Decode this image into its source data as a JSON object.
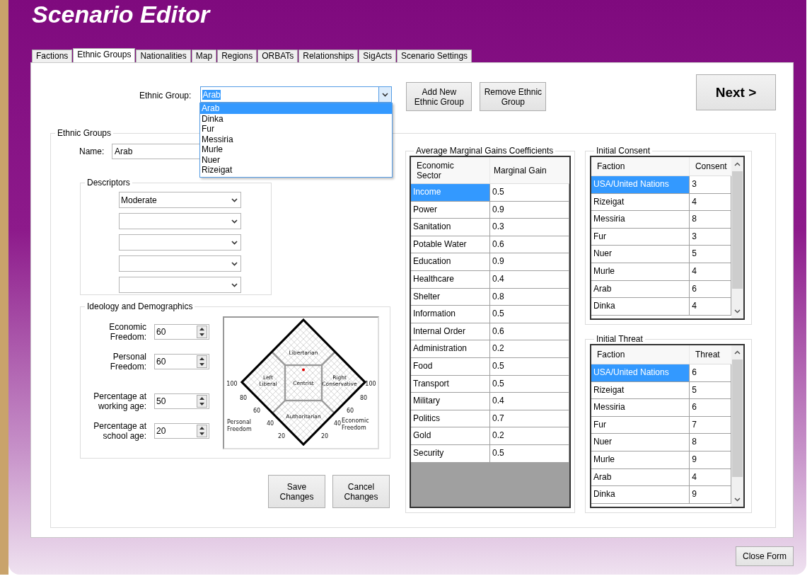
{
  "window": {
    "title": "Scenario Editor"
  },
  "tabs": [
    {
      "label": "Factions",
      "selected": false
    },
    {
      "label": "Ethnic Groups",
      "selected": true
    },
    {
      "label": "Nationalities",
      "selected": false
    },
    {
      "label": "Map",
      "selected": false
    },
    {
      "label": "Regions",
      "selected": false
    },
    {
      "label": "ORBATs",
      "selected": false
    },
    {
      "label": "Relationships",
      "selected": false
    },
    {
      "label": "SigActs",
      "selected": false
    },
    {
      "label": "Scenario Settings",
      "selected": false
    }
  ],
  "ethnic_group_selector": {
    "label": "Ethnic Group:",
    "value": "Arab",
    "expanded": true,
    "options": [
      {
        "label": "Arab",
        "selected": true
      },
      {
        "label": "Dinka",
        "selected": false
      },
      {
        "label": "Fur",
        "selected": false
      },
      {
        "label": "Messiria",
        "selected": false
      },
      {
        "label": "Murle",
        "selected": false
      },
      {
        "label": "Nuer",
        "selected": false
      },
      {
        "label": "Rizeigat",
        "selected": false
      }
    ]
  },
  "top_buttons": [
    {
      "label": "Add New\nEthnic Group"
    },
    {
      "label": "Remove Ethnic\nGroup"
    }
  ],
  "next_button": {
    "label": "Next >"
  },
  "ethnic_groups": {
    "title": "Ethnic Groups",
    "name_label": "Name:",
    "name_value": "Arab",
    "descriptors": {
      "title": "Descriptors",
      "slots": [
        {
          "kind": "selected",
          "value": "Moderate"
        },
        {
          "kind": "empty"
        },
        {
          "kind": "empty"
        },
        {
          "kind": "empty"
        },
        {
          "kind": "empty"
        }
      ]
    },
    "ideology": {
      "title": "Ideology and Demographics",
      "fields": [
        {
          "label": "Economic\nFreedom:",
          "value": "60"
        },
        {
          "label": "Personal\nFreedom:",
          "value": "60"
        },
        {
          "label": "Percentage at\nworking age:",
          "value": "50"
        },
        {
          "label": "Percentage at\nschool age:",
          "value": "20"
        }
      ],
      "diagram": {
        "regions": [
          "Libertarian",
          "Left\nLiberal",
          "Centrist",
          "Right\nConservative",
          "Authoritarian"
        ],
        "left_ticks": [
          "100",
          "80",
          "60",
          "40",
          "20"
        ],
        "right_ticks": [
          "20",
          "40",
          "60",
          "80",
          "100"
        ],
        "left_axis": "Personal\nFreedom",
        "right_axis": "Economic\nFreedom"
      }
    },
    "actions": [
      {
        "label": "Save\nChanges"
      },
      {
        "label": "Cancel\nChanges"
      }
    ]
  },
  "marginal_gains": {
    "title": "Average Marginal Gains Coefficients",
    "columns": [
      "Economic\nSector",
      "Marginal Gain"
    ],
    "rows": [
      {
        "cells": [
          "Income",
          "0.5"
        ],
        "selected": true
      },
      {
        "cells": [
          "Power",
          "0.9"
        ],
        "selected": false
      },
      {
        "cells": [
          "Sanitation",
          "0.3"
        ],
        "selected": false
      },
      {
        "cells": [
          "Potable Water",
          "0.6"
        ],
        "selected": false
      },
      {
        "cells": [
          "Education",
          "0.9"
        ],
        "selected": false
      },
      {
        "cells": [
          "Healthcare",
          "0.4"
        ],
        "selected": false
      },
      {
        "cells": [
          "Shelter",
          "0.8"
        ],
        "selected": false
      },
      {
        "cells": [
          "Information",
          "0.5"
        ],
        "selected": false
      },
      {
        "cells": [
          "Internal Order",
          "0.6"
        ],
        "selected": false
      },
      {
        "cells": [
          "Administration",
          "0.2"
        ],
        "selected": false
      },
      {
        "cells": [
          "Food",
          "0.5"
        ],
        "selected": false
      },
      {
        "cells": [
          "Transport",
          "0.5"
        ],
        "selected": false
      },
      {
        "cells": [
          "Military",
          "0.4"
        ],
        "selected": false
      },
      {
        "cells": [
          "Politics",
          "0.7"
        ],
        "selected": false
      },
      {
        "cells": [
          "Gold",
          "0.2"
        ],
        "selected": false
      },
      {
        "cells": [
          "Security",
          "0.5"
        ],
        "selected": false
      }
    ]
  },
  "initial_consent": {
    "title": "Initial Consent",
    "columns": [
      "Faction",
      "Consent"
    ],
    "rows": [
      {
        "cells": [
          "USA/United Nations",
          "3"
        ],
        "selected": true
      },
      {
        "cells": [
          "Rizeigat",
          "4"
        ],
        "selected": false
      },
      {
        "cells": [
          "Messiria",
          "8"
        ],
        "selected": false
      },
      {
        "cells": [
          "Fur",
          "3"
        ],
        "selected": false
      },
      {
        "cells": [
          "Nuer",
          "5"
        ],
        "selected": false
      },
      {
        "cells": [
          "Murle",
          "4"
        ],
        "selected": false
      },
      {
        "cells": [
          "Arab",
          "6"
        ],
        "selected": false
      },
      {
        "cells": [
          "Dinka",
          "4"
        ],
        "selected": false
      }
    ]
  },
  "initial_threat": {
    "title": "Initial Threat",
    "columns": [
      "Faction",
      "Threat"
    ],
    "rows": [
      {
        "cells": [
          "USA/United Nations",
          "6"
        ],
        "selected": true
      },
      {
        "cells": [
          "Rizeigat",
          "5"
        ],
        "selected": false
      },
      {
        "cells": [
          "Messiria",
          "6"
        ],
        "selected": false
      },
      {
        "cells": [
          "Fur",
          "7"
        ],
        "selected": false
      },
      {
        "cells": [
          "Nuer",
          "8"
        ],
        "selected": false
      },
      {
        "cells": [
          "Murle",
          "9"
        ],
        "selected": false
      },
      {
        "cells": [
          "Arab",
          "4"
        ],
        "selected": false
      },
      {
        "cells": [
          "Dinka",
          "9"
        ],
        "selected": false
      }
    ]
  },
  "close_button": {
    "label": "Close Form"
  }
}
